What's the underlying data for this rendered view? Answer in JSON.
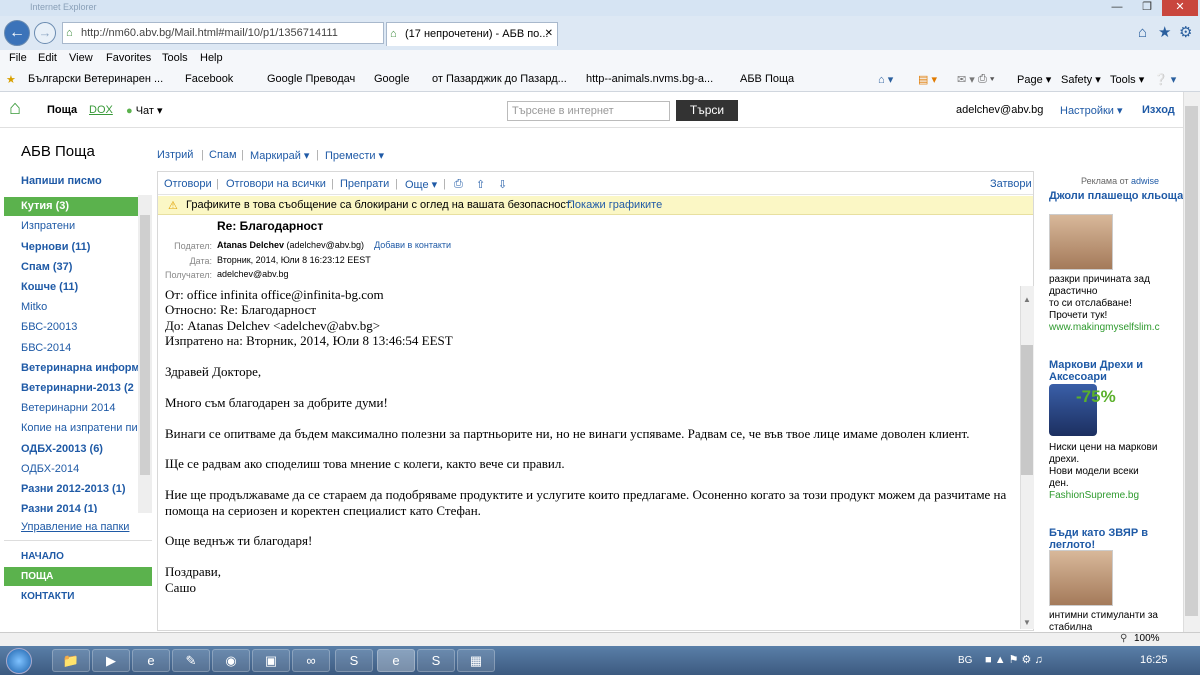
{
  "titlebar": {
    "left_text": "Internet Explorer",
    "right_text": "",
    "min": "—",
    "max": "❐",
    "close": "✕"
  },
  "browser": {
    "address": "http://nm60.abv.bg/Mail.html#mail/10/p1/1356714111",
    "tab_title": "(17 непрочетени) - АБВ по...",
    "menu": [
      "File",
      "Edit",
      "View",
      "Favorites",
      "Tools",
      "Help"
    ],
    "favorites": [
      "Български Ветеринарен ...",
      "Facebook",
      "Google Преводач",
      "Google",
      "от Пазарджик до Пазард...",
      "http--animals.nvms.bg-a...",
      "АБВ Поща"
    ],
    "cmd": {
      "page": "Page ▾",
      "safety": "Safety ▾",
      "tools": "Tools ▾"
    }
  },
  "mail_header": {
    "brand": "Поща",
    "dox": "DOX",
    "chat": "Чат ▾",
    "search_placeholder": "Търсене в интернет",
    "search_button": "Търси",
    "user": "adelchev@abv.bg",
    "settings": "Настройки ▾",
    "logout": "Изход"
  },
  "sidebar": {
    "title": "АБВ Поща",
    "compose": "Напиши писмо",
    "folders": [
      {
        "label": "Кутия (3)",
        "bold": true,
        "active": true
      },
      {
        "label": "Изпратени",
        "bold": false
      },
      {
        "label": "Чернови (11)",
        "bold": true
      },
      {
        "label": "Спам (37)",
        "bold": true
      },
      {
        "label": "Кошче (11)",
        "bold": true
      },
      {
        "label": "Mitko",
        "bold": false
      },
      {
        "label": "БВС-20013",
        "bold": false
      },
      {
        "label": "БВС-2014",
        "bold": false
      },
      {
        "label": "Ветеринарна информ",
        "bold": true
      },
      {
        "label": "Ветеринарни-2013 (2",
        "bold": true
      },
      {
        "label": "Ветеринарни 2014",
        "bold": false
      },
      {
        "label": "Копие на изпратени пис",
        "bold": false
      },
      {
        "label": "ОДБХ-20013 (6)",
        "bold": true
      },
      {
        "label": "ОДБХ-2014",
        "bold": false
      },
      {
        "label": "Разни 2012-2013 (1)",
        "bold": true
      },
      {
        "label": "Разни 2014 (1)",
        "bold": true
      }
    ],
    "manage": "Управление на папки",
    "bottom": [
      "НАЧАЛО",
      "ПОЩА",
      "КОНТАКТИ"
    ]
  },
  "toolbar": {
    "delete": "Изтрий",
    "spam": "Спам",
    "mark": "Маркирай ▾",
    "move": "Премести ▾"
  },
  "message": {
    "reply": "Отговори",
    "reply_all": "Отговори на всички",
    "forward": "Препрати",
    "more": "Още ▾",
    "close": "Затвори",
    "warning": "Графиките в това съобщение са блокирани с оглед на вашата безопасност.",
    "show_images": "Покажи графиките",
    "subject": "Re: Благодарност",
    "from_label": "Подател:",
    "from_name": "Atanas Delchev",
    "from_email": "(adelchev@abv.bg)",
    "add_contact": "Добави в контакти",
    "date_label": "Дата:",
    "date": "Вторник, 2014, Юли 8 16:23:12 EEST",
    "to_label": "Получател:",
    "to": "adelchev@abv.bg",
    "body": [
      "От: office infinita office@infinita-bg.com",
      "Относно: Re: Благодарност",
      "До: Atanas Delchev <adelchev@abv.bg>",
      "Изпратено на: Вторник, 2014, Юли 8 13:46:54 EEST",
      "",
      "Здравей Докторе,",
      "",
      "Много съм благодарен за добрите думи!",
      "",
      "Винаги се опитваме да бъдем максимално полезни за партньорите ни, но не винаги успяваме. Радвам се, че във твое лице имаме доволен клиент.",
      "",
      "Ще се радвам ако споделиш това мнение с колеги, както вече си правил.",
      "",
      "Ние ще продължаваме да се стараем да подобряваме продуктите и услугите които предлагаме. Осоненно когато за този продукт можем да разчитаме на помоща на сериозен и коректен специалист като Стефан.",
      "",
      "Още веднъж ти благодаря!",
      "",
      "Поздрави,",
      "Сашо"
    ]
  },
  "ads": {
    "header": "Реклама от",
    "brand": "adwise",
    "items": [
      {
        "title": "Джоли плашещо кльощава...",
        "text": [
          "разкри причината зад",
          "драстично",
          "то си отслабване!",
          "Прочети тук!"
        ],
        "link": "www.makingmyselfslim.c"
      },
      {
        "title": "Маркови Дрехи и Аксесоари",
        "text": [
          "Ниски цени на маркови",
          "дрехи.",
          "Нови модели всеки",
          "ден."
        ],
        "link": "FashionSupreme.bg",
        "badge": "-75%"
      },
      {
        "title": "Бъди като ЗВЯР в леглото!",
        "text": [
          "интимни стимуланти за",
          "стабилна"
        ],
        "link": ""
      }
    ]
  },
  "statusbar": {
    "zoom": "100%"
  },
  "taskbar": {
    "lang": "BG",
    "clock": "16:25"
  }
}
